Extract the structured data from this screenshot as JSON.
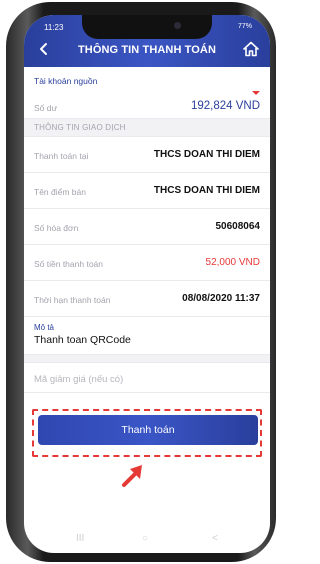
{
  "status": {
    "time": "11:23",
    "battery": "77%"
  },
  "header": {
    "title": "THÔNG TIN THANH TOÁN"
  },
  "source": {
    "label": "Tài khoản nguồn",
    "balance_label": "Số dư",
    "balance_value": "192,824 VND"
  },
  "transaction": {
    "section_title": "THÔNG TIN GIAO DỊCH",
    "rows": [
      {
        "label": "Thanh toán tại",
        "value": "THCS DOAN THI DIEM"
      },
      {
        "label": "Tên điểm bán",
        "value": "THCS DOAN THI DIEM"
      },
      {
        "label": "Số hóa đơn",
        "value": "50608064"
      },
      {
        "label": "Số tiền thanh toán",
        "value": "52,000 VND"
      },
      {
        "label": "Thời hạn thanh toán",
        "value": "08/08/2020 11:37"
      }
    ]
  },
  "description": {
    "label": "Mô tả",
    "value": "Thanh toan QRCode"
  },
  "discount": {
    "placeholder": "Mã giảm giá (nếu có)"
  },
  "actions": {
    "pay_label": "Thanh toán"
  },
  "nav": {
    "recent": "III",
    "home": "○",
    "back": "<"
  },
  "colors": {
    "brand": "#2a3f9c",
    "accent_red": "#e53935"
  }
}
